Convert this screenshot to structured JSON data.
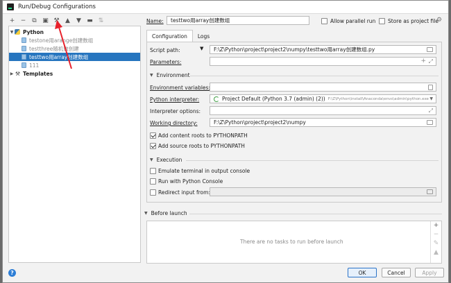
{
  "window": {
    "title": "Run/Debug Configurations"
  },
  "toolbar": {
    "icons": [
      "plus-icon",
      "minus-icon",
      "copy-icon",
      "save-icon",
      "wrench-icon",
      "arrow-up-icon",
      "arrow-down-icon",
      "folder-icon",
      "sort-icon"
    ]
  },
  "tree": {
    "python_label": "Python",
    "items": [
      {
        "label": "testone用arange创建数组",
        "selected": false
      },
      {
        "label": "testthree随机数创建",
        "selected": false
      },
      {
        "label": "testtwo用array创建数组",
        "selected": true
      },
      {
        "label": "111",
        "selected": false
      }
    ],
    "templates_label": "Templates"
  },
  "header": {
    "name_label": "Name:",
    "name_value": "testtwo用array创建数组",
    "allow_parallel_label": "Allow parallel run",
    "store_project_label": "Store as project file"
  },
  "tabs": [
    {
      "label": "Configuration",
      "active": true
    },
    {
      "label": "Logs",
      "active": false
    }
  ],
  "config": {
    "script_path_label": "Script path:",
    "script_path_value": "F:\\Z\\Python\\project\\project2\\numpy\\testtwo用array创建数组.py",
    "parameters_label": "Parameters:",
    "parameters_value": "",
    "environment_section": "Environment",
    "env_vars_label": "Environment variables:",
    "env_vars_value": "",
    "interpreter_label": "Python interpreter:",
    "interpreter_value": "Project Default (Python 3.7 (admin) (2))",
    "interpreter_path": "F:\\Z\\Python\\install\\Anaconda\\envs\\admin\\python.exe",
    "interpreter_options_label": "Interpreter options:",
    "interpreter_options_value": "",
    "working_dir_label": "Working directory:",
    "working_dir_value": "F:\\Z\\Python\\project\\project2\\numpy",
    "add_content_roots_label": "Add content roots to PYTHONPATH",
    "add_source_roots_label": "Add source roots to PYTHONPATH",
    "execution_section": "Execution",
    "emulate_terminal_label": "Emulate terminal in output console",
    "run_with_console_label": "Run with Python Console",
    "redirect_input_label": "Redirect input from:"
  },
  "before_launch": {
    "title": "Before launch",
    "empty_text": "There are no tasks to run before launch"
  },
  "footer": {
    "help_icon": "?",
    "ok_label": "OK",
    "cancel_label": "Cancel",
    "apply_label": "Apply"
  },
  "colors": {
    "selection": "#2675bf",
    "annotation_arrow": "#e8212b"
  }
}
